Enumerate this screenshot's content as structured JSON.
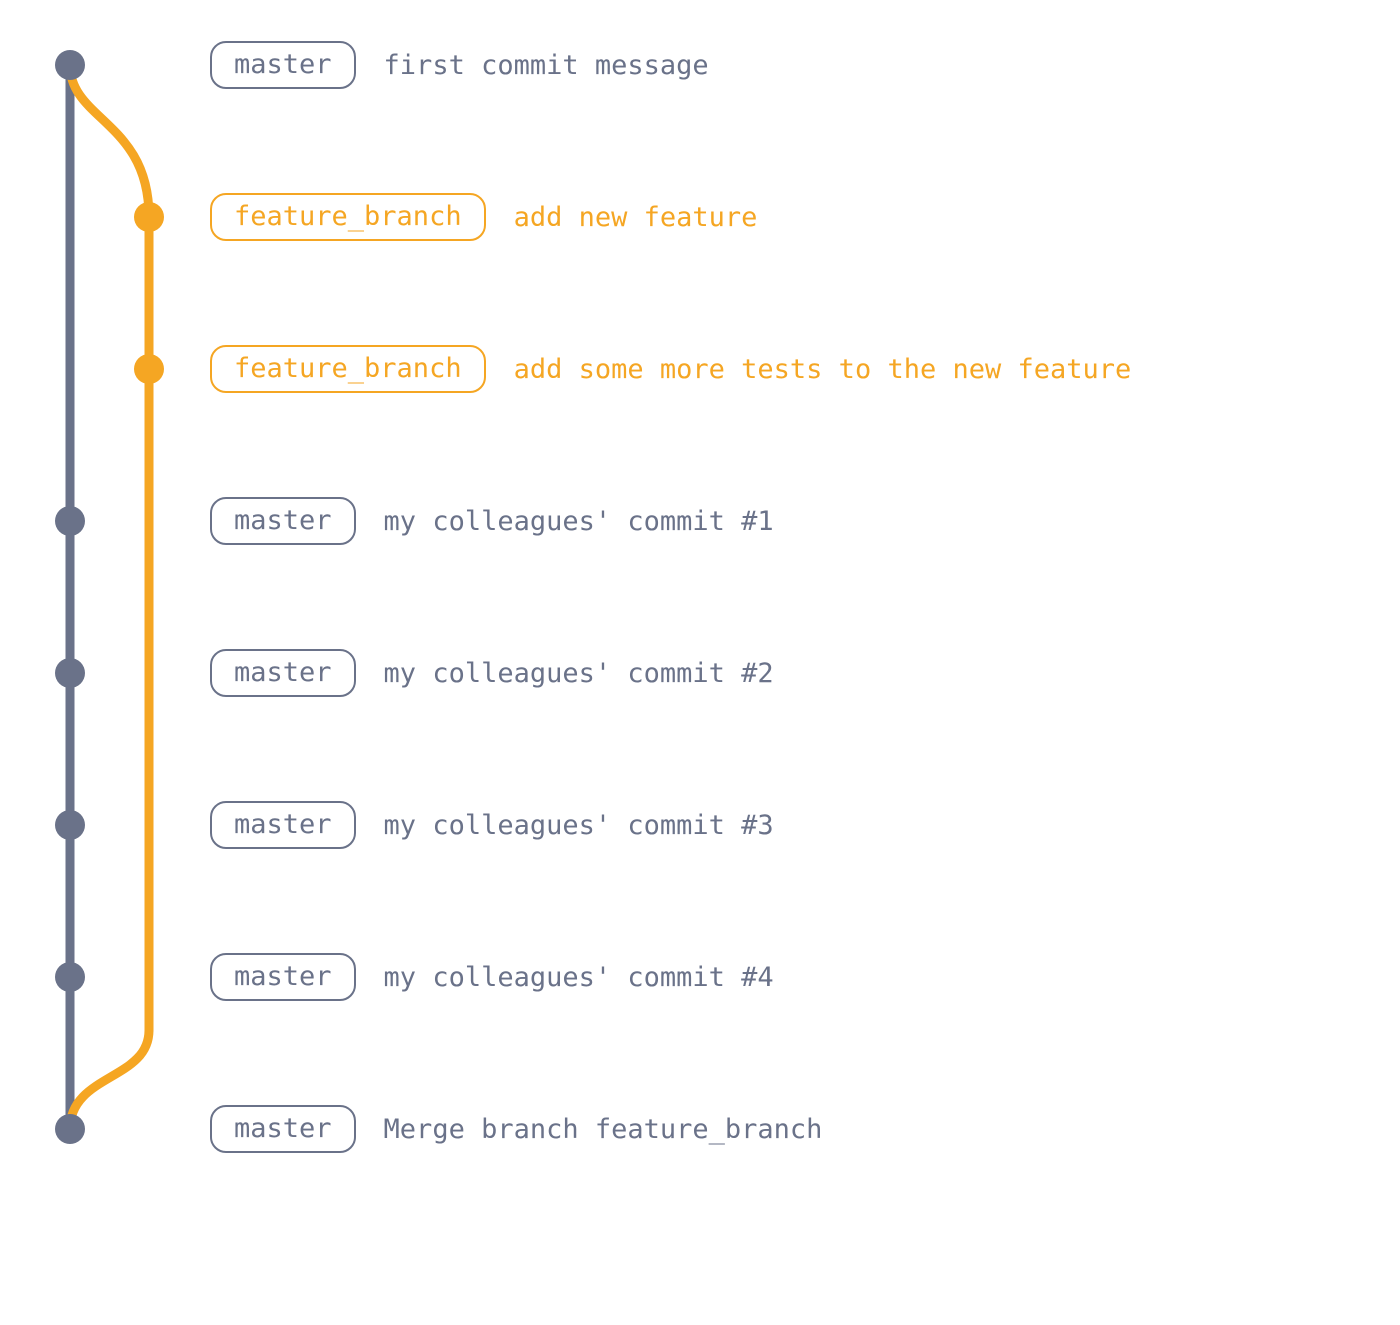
{
  "colors": {
    "master": "#6a7289",
    "feature": "#f5a623",
    "masterNode": "#6a7289",
    "featureNode": "#f5a623"
  },
  "layout": {
    "lanes": {
      "master": 70,
      "feature": 149
    },
    "labelX": 210,
    "rowSpacing": 152,
    "firstRowY": 65,
    "nodeRadius": 15,
    "strokeWidth": 9
  },
  "commits": [
    {
      "id": "c0",
      "lane": "master",
      "branchLabel": "master",
      "badgeClass": "c-master",
      "textClass": "t-master",
      "message": "first commit message"
    },
    {
      "id": "c1",
      "lane": "feature",
      "branchLabel": "feature_branch",
      "badgeClass": "c-feature",
      "textClass": "t-feature",
      "message": "add new feature"
    },
    {
      "id": "c2",
      "lane": "feature",
      "branchLabel": "feature_branch",
      "badgeClass": "c-feature",
      "textClass": "t-feature",
      "message": "add some more tests to the new feature"
    },
    {
      "id": "c3",
      "lane": "master",
      "branchLabel": "master",
      "badgeClass": "c-master",
      "textClass": "t-master",
      "message": "my colleagues' commit #1"
    },
    {
      "id": "c4",
      "lane": "master",
      "branchLabel": "master",
      "badgeClass": "c-master",
      "textClass": "t-master",
      "message": "my colleagues' commit #2"
    },
    {
      "id": "c5",
      "lane": "master",
      "branchLabel": "master",
      "badgeClass": "c-master",
      "textClass": "t-master",
      "message": "my colleagues' commit #3"
    },
    {
      "id": "c6",
      "lane": "master",
      "branchLabel": "master",
      "badgeClass": "c-master",
      "textClass": "t-master",
      "message": "my colleagues' commit #4"
    },
    {
      "id": "c7",
      "lane": "master",
      "branchLabel": "master",
      "badgeClass": "c-master",
      "textClass": "t-master",
      "message": "Merge branch feature_branch"
    }
  ]
}
